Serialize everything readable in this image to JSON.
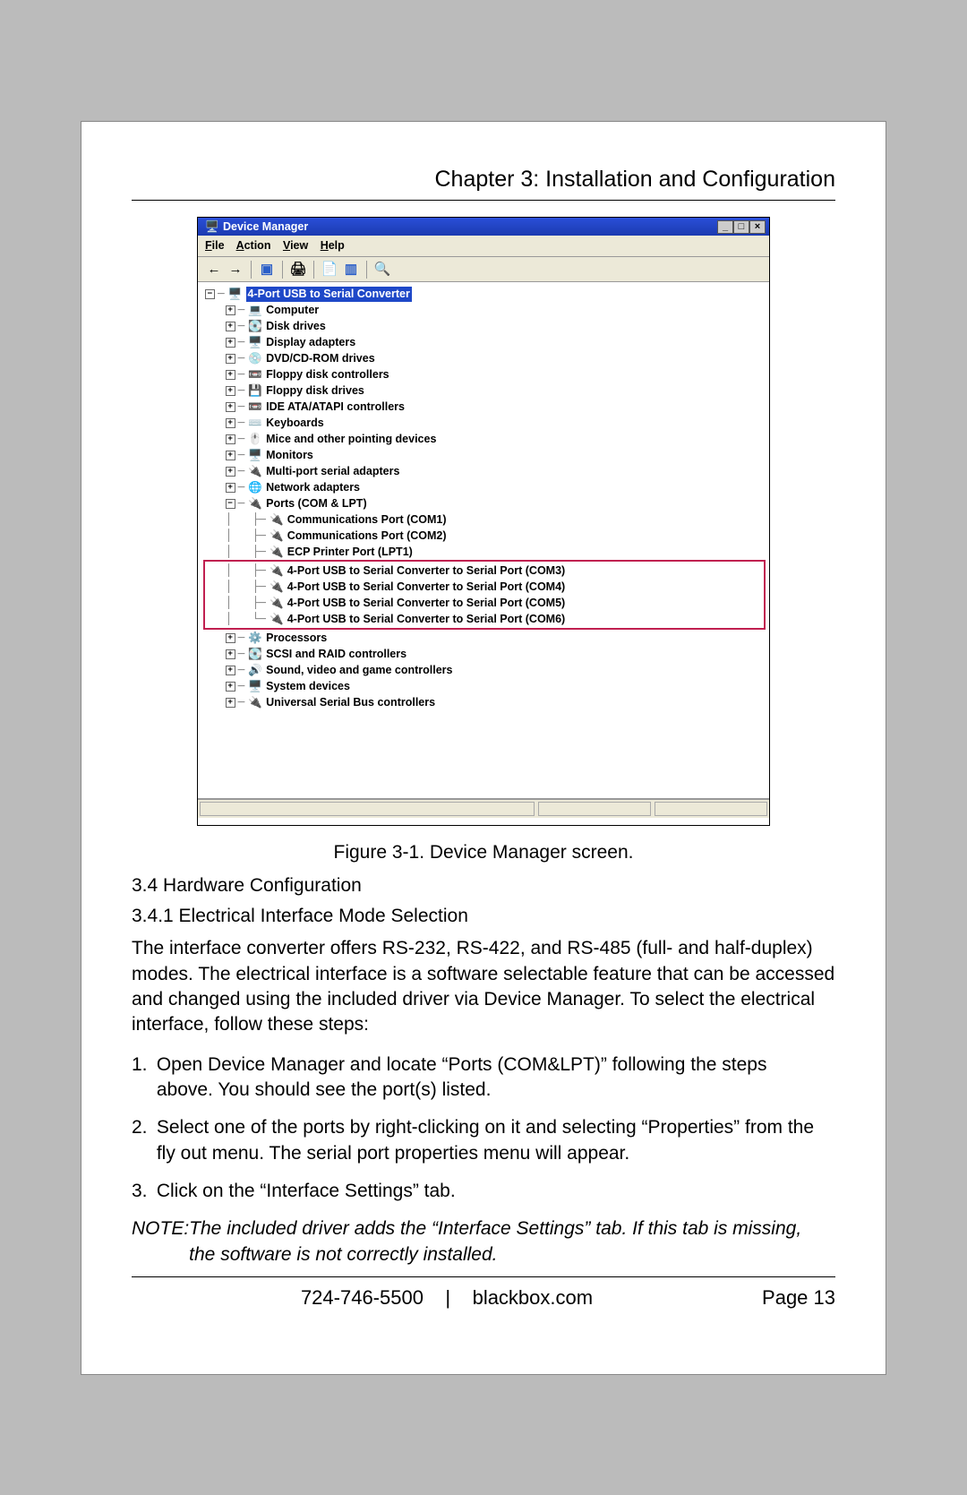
{
  "chapter_title": "Chapter 3: Installation and Configuration",
  "caption": "Figure 3-1. Device Manager screen.",
  "sections": {
    "s34": "3.4 Hardware Configuration",
    "s341": "3.4.1 Electrical Interface Mode Selection"
  },
  "body_p1": "The interface converter offers RS-232, RS-422, and RS-485 (full- and half-duplex) modes. The electrical interface is a software selectable feature that can be accessed and changed using the included driver via Device Manager. To select the electrical interface, follow these steps:",
  "steps": {
    "s1": "Open Device Manager and locate “Ports (COM&LPT)” following the steps above. You should see the port(s) listed.",
    "s2": "Select one of the ports by right-clicking on it and selecting “Properties” from the fly out menu. The serial port properties menu will appear.",
    "s3": "Click on the “Interface Settings” tab."
  },
  "note": {
    "label": "NOTE: ",
    "text": "The included driver adds the “Interface Settings” tab. If this tab is missing, the software is not correctly installed."
  },
  "footer": {
    "phone": "724-746-5500",
    "sep": "|",
    "site": "blackbox.com",
    "page": "Page 13"
  },
  "dm": {
    "title": "Device Manager",
    "menu": {
      "file": "File",
      "action": "Action",
      "view": "View",
      "help": "Help"
    },
    "root": "4-Port USB to Serial Converter",
    "nodes": [
      "Computer",
      "Disk drives",
      "Display adapters",
      "DVD/CD-ROM drives",
      "Floppy disk controllers",
      "Floppy disk drives",
      "IDE ATA/ATAPI controllers",
      "Keyboards",
      "Mice and other pointing devices",
      "Monitors",
      "Multi-port serial adapters",
      "Network adapters",
      "Ports (COM & LPT)"
    ],
    "ports_children": [
      "Communications Port (COM1)",
      "Communications Port (COM2)",
      "ECP Printer Port (LPT1)"
    ],
    "highlighted_ports": [
      "4-Port USB to Serial Converter to Serial Port (COM3)",
      "4-Port USB to Serial Converter to Serial Port (COM4)",
      "4-Port USB to Serial Converter to Serial Port (COM5)",
      "4-Port USB to Serial Converter to Serial Port (COM6)"
    ],
    "after_ports": [
      "Processors",
      "SCSI and RAID controllers",
      "Sound, video and game controllers",
      "System devices",
      "Universal Serial Bus controllers"
    ]
  }
}
